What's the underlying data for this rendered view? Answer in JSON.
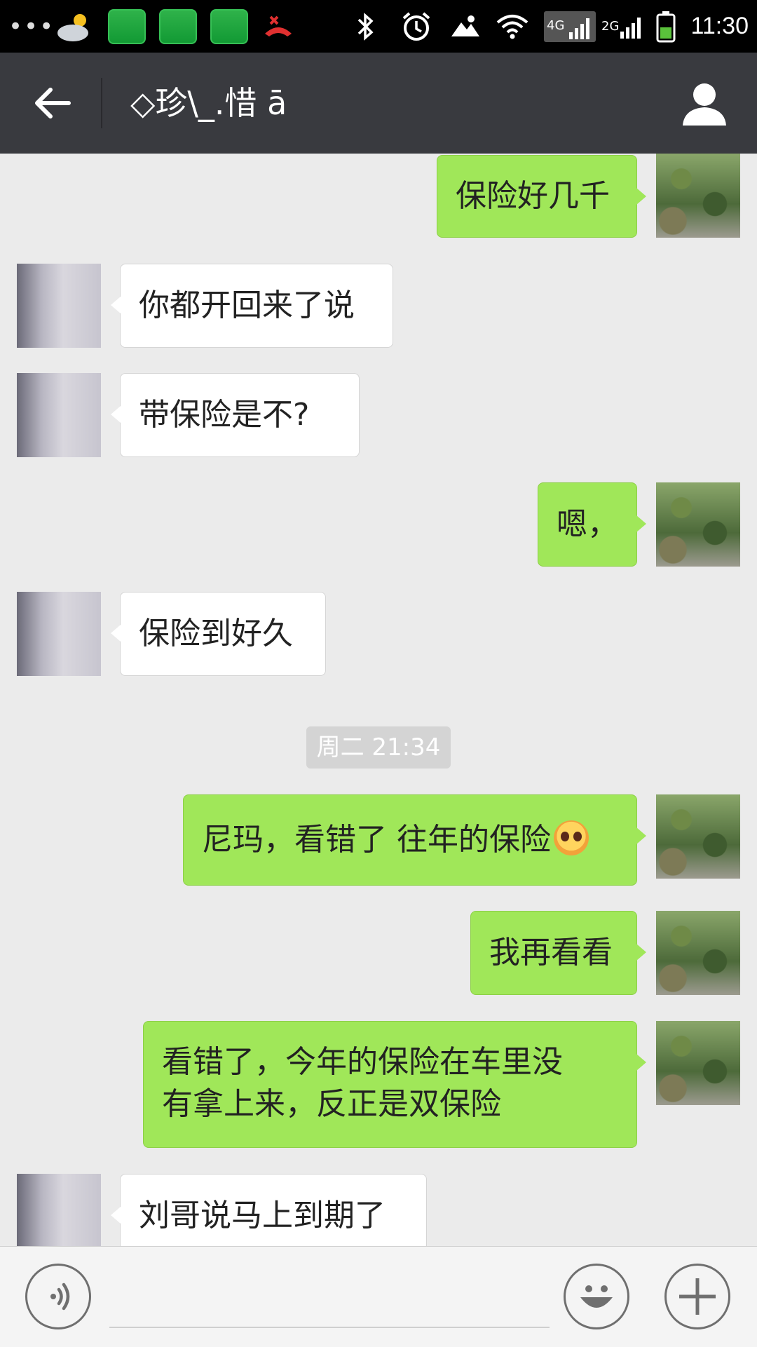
{
  "status_bar": {
    "time": "11:30",
    "network_4g": "4G",
    "network_2g": "2G",
    "icons": [
      "more-dots-icon",
      "weather-icon",
      "app-icon",
      "app-icon",
      "app-icon",
      "missed-call-icon",
      "bluetooth-icon",
      "alarm-icon",
      "sync-icon",
      "wifi-icon",
      "signal-4g-icon",
      "signal-2g-icon",
      "battery-icon"
    ]
  },
  "header": {
    "title": "◇珍\\_.惜 ā"
  },
  "messages": [
    {
      "side": "right",
      "text": "保险好几千"
    },
    {
      "side": "left",
      "text": "你都开回来了说"
    },
    {
      "side": "left",
      "text": "带保险是不?"
    },
    {
      "side": "right",
      "text": "嗯，"
    },
    {
      "side": "left",
      "text": "保险到好久"
    },
    {
      "side": "right",
      "text": "尼玛，看错了 往年的保险"
    },
    {
      "side": "right",
      "text": "我再看看"
    },
    {
      "side": "right",
      "line1": "看错了，今年的保险在车里没",
      "line2": "有拿上来，反正是双保险"
    },
    {
      "side": "left",
      "text": "刘哥说马上到期了"
    }
  ],
  "timestamp": "周二 21:34",
  "input": {
    "value": "",
    "placeholder": ""
  },
  "colors": {
    "header_bg": "#393a3f",
    "sent_bubble": "#a0e759",
    "received_bubble": "#ffffff",
    "chat_bg": "#ebebeb"
  }
}
